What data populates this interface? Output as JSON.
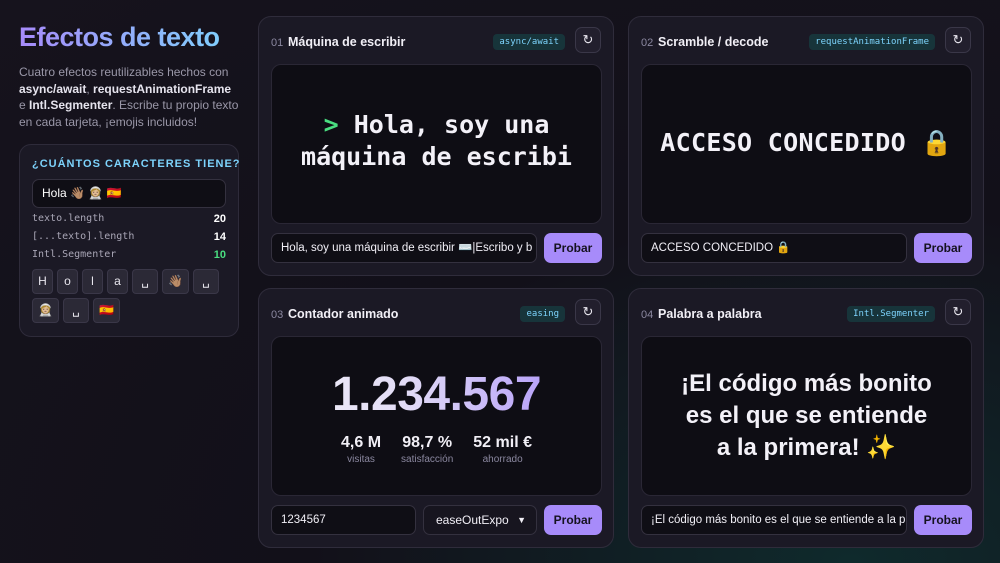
{
  "sidebar": {
    "title": "Efectos de texto",
    "intro_1": "Cuatro efectos reutilizables hechos con ",
    "intro_b1": "async/await",
    "intro_2": ", ",
    "intro_b2": "requestAnimationFrame",
    "intro_3": " e ",
    "intro_b3": "Intl.Segmenter",
    "intro_4": ". Escribe tu propio texto en cada tarjeta, ¡emojis incluidos!",
    "counter": {
      "heading": "¿CUÁNTOS CARACTERES TIENE?",
      "input_value": "Hola 👋🏽 👩🏼‍🚀 🇪🇸",
      "metrics": [
        {
          "key": "texto.length",
          "value": "20"
        },
        {
          "key": "[...texto].length",
          "value": "14"
        },
        {
          "key": "Intl.Segmenter",
          "value": "10"
        }
      ],
      "chips": [
        "H",
        "o",
        "l",
        "a",
        "␣",
        "👋🏽",
        "␣",
        "👩🏼‍🚀",
        "␣",
        "🇪🇸"
      ]
    }
  },
  "cards": [
    {
      "num": "01",
      "title": "Máquina de escribir",
      "tag": "async/await",
      "reset_icon": "↻",
      "prompt": ">",
      "line1": "Hola, soy una",
      "line2": "máquina de escribi",
      "input_value": "Hola, soy una máquina de escribir ⌨️|Escribo y b",
      "button": "Probar"
    },
    {
      "num": "02",
      "title": "Scramble / decode",
      "tag": "requestAnimationFrame",
      "reset_icon": "↻",
      "display": "ACCESO CONCEDIDO 🔒",
      "input_value": "ACCESO CONCEDIDO 🔒",
      "button": "Probar"
    },
    {
      "num": "03",
      "title": "Contador animado",
      "tag": "easing",
      "reset_icon": "↻",
      "main_value": "1.234.567",
      "stats": [
        {
          "value": "4,6 M",
          "label": "visitas"
        },
        {
          "value": "98,7 %",
          "label": "satisfacción"
        },
        {
          "value": "52 mil €",
          "label": "ahorrado"
        }
      ],
      "input_value": "1234567",
      "select_value": "easeOutExpo",
      "button": "Probar"
    },
    {
      "num": "04",
      "title": "Palabra a palabra",
      "tag": "Intl.Segmenter",
      "reset_icon": "↻",
      "line1": "¡El código más bonito",
      "line2": "es el que se entiende",
      "line3": "a la primera! ✨",
      "input_value": "¡El código más bonito es el que se entiende a la p",
      "button": "Probar"
    }
  ],
  "colors": {
    "accent": "#a78bfa",
    "cyan": "#7dd3fc",
    "green": "#4ade80",
    "background": "#15131c",
    "card": "#1b1925"
  }
}
